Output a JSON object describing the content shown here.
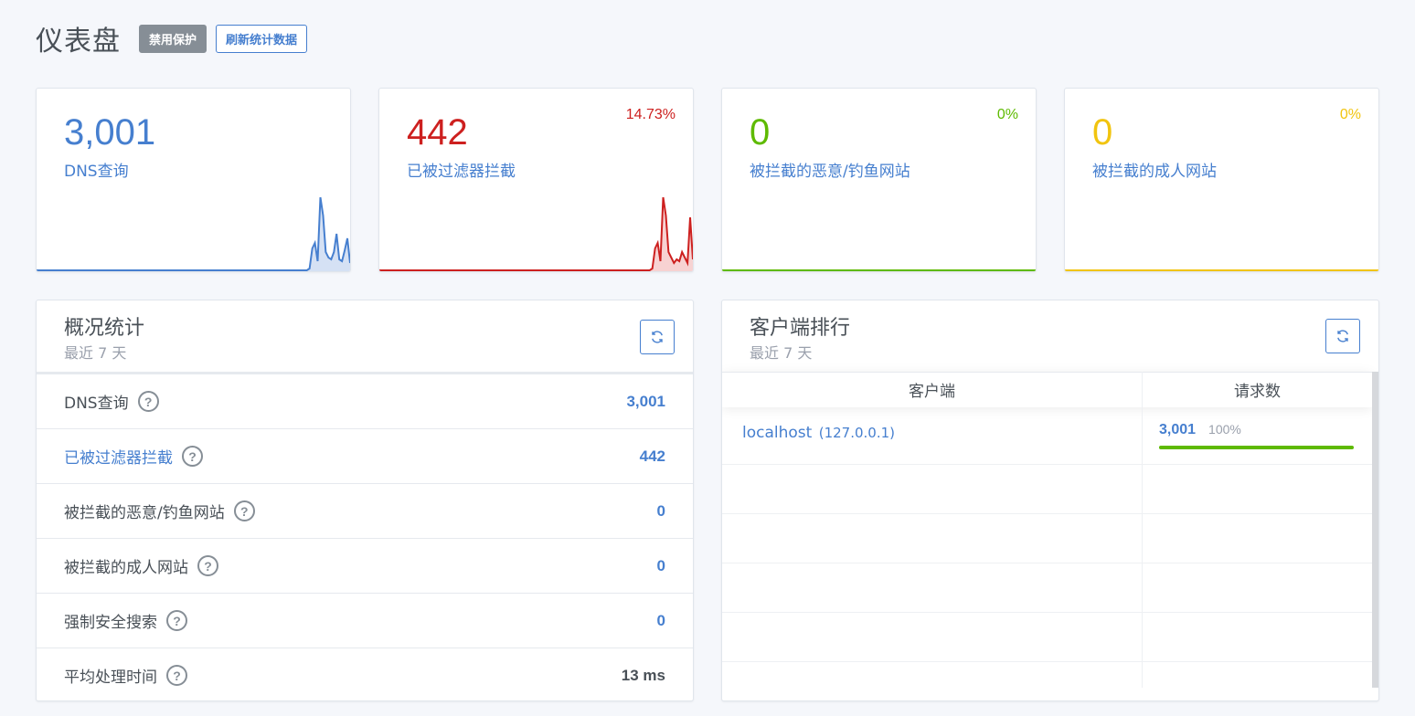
{
  "header": {
    "title": "仪表盘",
    "disable_label": "禁用保护",
    "refresh_label": "刷新统计数据"
  },
  "stat_cards": [
    {
      "value": "3,001",
      "label": "DNS查询",
      "percent": "",
      "color": "#467fcf",
      "fill": "#d5e1f4"
    },
    {
      "value": "442",
      "label": "已被过滤器拦截",
      "percent": "14.73%",
      "color": "#cd201f",
      "fill": "#f7d2d2"
    },
    {
      "value": "0",
      "label": "被拦截的恶意/钓鱼网站",
      "percent": "0%",
      "color": "#5eba00",
      "fill": "#e0f0cc"
    },
    {
      "value": "0",
      "label": "被拦截的成人网站",
      "percent": "0%",
      "color": "#f1c40f",
      "fill": "#fbf0c5"
    }
  ],
  "sparklines": {
    "queries": [
      0,
      0,
      0,
      0,
      0,
      0,
      0,
      0,
      0,
      0,
      0,
      0,
      0,
      0,
      0,
      0,
      0,
      0,
      0,
      0,
      0,
      0,
      0,
      0,
      0,
      0,
      0,
      0,
      0,
      0,
      0,
      0,
      0,
      0,
      0,
      0,
      0,
      0,
      0,
      0,
      0,
      0,
      0,
      0,
      0,
      0,
      0,
      0,
      0,
      0,
      0,
      0,
      0,
      0,
      0,
      0,
      0,
      0,
      0,
      0,
      0,
      0,
      0,
      0,
      0,
      0,
      0,
      0,
      0,
      0,
      0,
      0,
      0,
      0,
      0,
      0,
      0,
      0,
      0,
      0,
      0,
      0,
      0,
      0,
      0,
      0,
      0,
      0,
      0,
      0,
      0,
      0,
      0,
      0,
      0,
      0,
      0,
      0,
      0,
      0,
      0,
      2,
      24,
      30,
      10,
      80,
      60,
      20,
      14,
      12,
      20,
      40,
      12,
      10,
      22,
      35,
      8
    ],
    "blocked": [
      0,
      0,
      0,
      0,
      0,
      0,
      0,
      0,
      0,
      0,
      0,
      0,
      0,
      0,
      0,
      0,
      0,
      0,
      0,
      0,
      0,
      0,
      0,
      0,
      0,
      0,
      0,
      0,
      0,
      0,
      0,
      0,
      0,
      0,
      0,
      0,
      0,
      0,
      0,
      0,
      0,
      0,
      0,
      0,
      0,
      0,
      0,
      0,
      0,
      0,
      0,
      0,
      0,
      0,
      0,
      0,
      0,
      0,
      0,
      0,
      0,
      0,
      0,
      0,
      0,
      0,
      0,
      0,
      0,
      0,
      0,
      0,
      0,
      0,
      0,
      0,
      0,
      0,
      0,
      0,
      0,
      0,
      0,
      0,
      0,
      0,
      0,
      0,
      0,
      0,
      0,
      0,
      0,
      0,
      0,
      0,
      0,
      0,
      0,
      0,
      0,
      2,
      24,
      30,
      10,
      80,
      60,
      20,
      14,
      8,
      12,
      10,
      20,
      14,
      8,
      58,
      12
    ]
  },
  "overview": {
    "title": "概况统计",
    "subtitle": "最近 7 天",
    "rows": [
      {
        "label": "DNS查询",
        "value": "3,001"
      },
      {
        "label": "已被过滤器拦截",
        "value": "442"
      },
      {
        "label": "被拦截的恶意/钓鱼网站",
        "value": "0"
      },
      {
        "label": "被拦截的成人网站",
        "value": "0"
      },
      {
        "label": "强制安全搜索",
        "value": "0"
      },
      {
        "label": "平均处理时间",
        "value": "13 ms"
      }
    ],
    "help_glyph": "?"
  },
  "clients": {
    "title": "客户端排行",
    "subtitle": "最近 7 天",
    "col_client": "客户端",
    "col_requests": "请求数",
    "rows": [
      {
        "name": "localhost",
        "ip": "(127.0.0.1)",
        "count": "3,001",
        "percent_label": "100%",
        "fraction": 1.0
      }
    ]
  }
}
